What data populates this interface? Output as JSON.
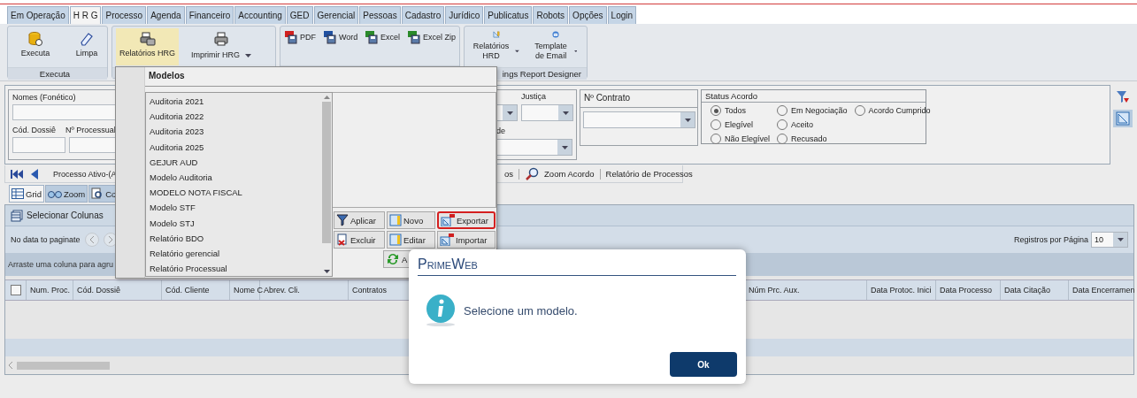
{
  "tabs": [
    {
      "label": "Em Operação",
      "selected": false
    },
    {
      "label": "H R G",
      "selected": true
    },
    {
      "label": "Processo",
      "selected": false
    },
    {
      "label": "Agenda",
      "selected": false
    },
    {
      "label": "Financeiro",
      "selected": false
    },
    {
      "label": "Accounting",
      "selected": false
    },
    {
      "label": "GED",
      "selected": false
    },
    {
      "label": "Gerencial",
      "selected": false
    },
    {
      "label": "Pessoas",
      "selected": false
    },
    {
      "label": "Cadastro",
      "selected": false
    },
    {
      "label": "Jurídico",
      "selected": false
    },
    {
      "label": "Publicatus",
      "selected": false
    },
    {
      "label": "Robots",
      "selected": false
    },
    {
      "label": "Opções",
      "selected": false
    },
    {
      "label": "Login",
      "selected": false
    }
  ],
  "ribbon": {
    "groups": [
      {
        "caption": "Executa",
        "items": [
          {
            "label": "Executa",
            "kind": "large",
            "selected": false
          },
          {
            "label": "Limpa",
            "kind": "large",
            "selected": false
          }
        ]
      },
      {
        "items": [
          {
            "label": "Relatórios HRG",
            "kind": "large",
            "selected": true
          },
          {
            "label": "Imprimir HRG",
            "kind": "menu",
            "selected": false
          }
        ]
      },
      {
        "items": [
          {
            "label": "PDF",
            "kind": "small",
            "selected": false
          },
          {
            "label": "Word",
            "kind": "small",
            "selected": false
          },
          {
            "label": "Excel",
            "kind": "small",
            "selected": false
          },
          {
            "label": "Excel Zip",
            "kind": "small",
            "selected": false
          }
        ]
      },
      {
        "caption": "ings Report Designer",
        "items": [
          {
            "label": "Relatórios HRD",
            "kind": "menu",
            "selected": false
          },
          {
            "label": "Template de Email",
            "kind": "menu",
            "selected": false
          }
        ]
      }
    ]
  },
  "filters": {
    "names_label": "Nomes (Fonético)",
    "dossie_label": "Cód. Dossiê",
    "processual_label": "Nº Processual",
    "justica_label": "Justiça",
    "de_label": "de",
    "contrato_label": "Nº Contrato",
    "status": {
      "title": "Status Acordo",
      "columns": [
        [
          {
            "label": "Todos",
            "selected": true
          },
          {
            "label": "Elegível",
            "selected": false
          },
          {
            "label": "Não Elegível",
            "selected": false
          }
        ],
        [
          {
            "label": "Em Negociação",
            "selected": false
          },
          {
            "label": "Aceito",
            "selected": false
          },
          {
            "label": "Recusado",
            "selected": false
          }
        ],
        [
          {
            "label": "Acordo Cumprido",
            "selected": false
          }
        ]
      ]
    }
  },
  "toolbar": {
    "active_text": "Processo Ativo-(A",
    "items": [
      {
        "label": "os"
      },
      {
        "label": "Zoom Acordo"
      },
      {
        "label": "Relatório de Processos"
      }
    ]
  },
  "view_tabs": [
    {
      "label": "Grid",
      "selected": true
    },
    {
      "label": "Zoom",
      "selected": false
    },
    {
      "label": "Co",
      "selected": false
    }
  ],
  "grid": {
    "select_columns": "Selecionar Colunas",
    "pager_text": "No data to paginate",
    "per_page_label": "Registros por Página",
    "per_page": "10",
    "group_hint": "Arraste uma coluna para agru",
    "all_checked": false,
    "columns": [
      "Num. Proc.",
      "Cód. Dossiê",
      "Cód. Cliente",
      "Nome C",
      "Abrev. Cli.",
      "Contratos",
      "Núm Prc. Aux.",
      "Data Protoc. Inici",
      "Data Processo",
      "Data Citação",
      "Data Encerramen"
    ]
  },
  "modelos": {
    "title": "Modelos",
    "items": [
      "Auditoria 2021",
      "Auditoria 2022",
      "Auditoria 2023",
      "Auditoria 2025",
      "GEJUR AUD",
      "Modelo Auditoria",
      "MODELO NOTA FISCAL",
      "Modelo STF",
      "Modelo STJ",
      "Relatório BDO",
      "Relatório gerencial",
      "Relatório Processual"
    ],
    "buttons": [
      {
        "label": "Aplicar",
        "focused": false
      },
      {
        "label": "Novo",
        "focused": false
      },
      {
        "label": "Exportar",
        "focused": true
      },
      {
        "label": "Excluir",
        "focused": false
      },
      {
        "label": "Editar",
        "focused": false
      },
      {
        "label": "Importar",
        "focused": false
      },
      {
        "label": "A",
        "focused": false
      }
    ]
  },
  "dialog": {
    "title": "PrimeWeb",
    "message": "Selecione um modelo.",
    "ok": "Ok"
  }
}
